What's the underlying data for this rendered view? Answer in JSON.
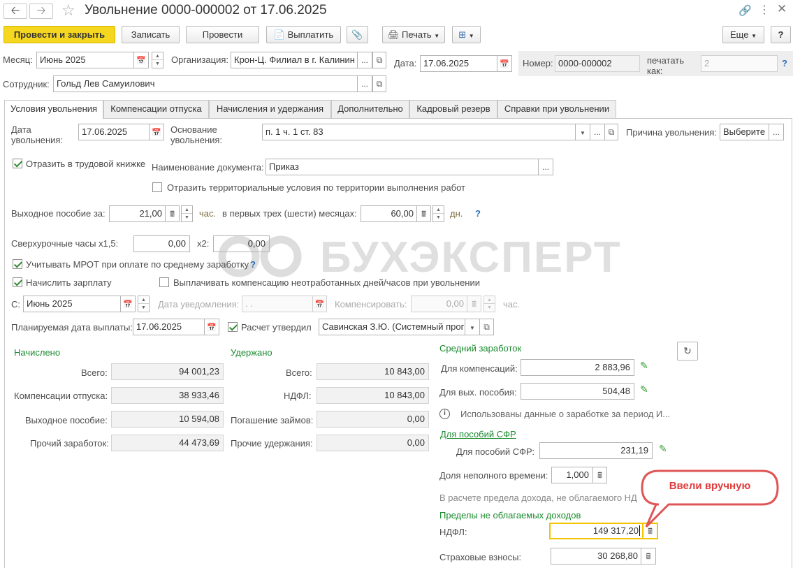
{
  "window": {
    "title": "Увольнение 0000-000002 от 17.06.2025"
  },
  "toolbar": {
    "post_close": "Провести и закрыть",
    "save": "Записать",
    "post": "Провести",
    "pay": "Выплатить",
    "print": "Печать",
    "more": "Еще",
    "help": "?"
  },
  "header": {
    "month_label": "Месяц:",
    "month_value": "Июнь 2025",
    "org_label": "Организация:",
    "org_value": "Крон-Ц. Филиал в г. Калинин",
    "date_label": "Дата:",
    "date_value": "17.06.2025",
    "number_label": "Номер:",
    "number_value": "0000-000002",
    "print_as_label": "печатать как:",
    "print_as_value": "2",
    "employee_label": "Сотрудник:",
    "employee_value": "Гольд Лев Самуилович"
  },
  "tabs": [
    {
      "label": "Условия увольнения"
    },
    {
      "label": "Компенсации отпуска"
    },
    {
      "label": "Начисления и удержания"
    },
    {
      "label": "Дополнительно"
    },
    {
      "label": "Кадровый резерв"
    },
    {
      "label": "Справки при увольнении"
    }
  ],
  "conditions": {
    "dismissal_date_label": "Дата увольнения:",
    "dismissal_date_value": "17.06.2025",
    "basis_label": "Основание увольнения:",
    "basis_value": "п. 1 ч. 1 ст. 83",
    "reason_label": "Причина увольнения:",
    "reason_value": "Выберите",
    "reflect_workbook_label": "Отразить в трудовой книжке",
    "doc_name_label": "Наименование документа:",
    "doc_name_value": "Приказ",
    "territorial_label": "Отразить территориальные условия по территории выполнения работ",
    "severance_label": "Выходное пособие за:",
    "severance_hours": "21,00",
    "hours_unit": "час.",
    "first_months_label": "в первых трех (шести) месяцах:",
    "first_months_days": "60,00",
    "days_unit": "дн.",
    "overtime_label": "Сверхурочные часы х1,5:",
    "overtime_15": "0,00",
    "x2_label": "х2:",
    "overtime_2": "0,00",
    "mrot_label": "Учитывать МРОТ при оплате по среднему заработку",
    "calc_salary_label": "Начислить зарплату",
    "pay_comp_label": "Выплачивать компенсацию неотработанных дней/часов при увольнении",
    "from_label": "С:",
    "from_value": "Июнь 2025",
    "notice_date_label": "Дата уведомления:",
    "notice_date_value": ".  .",
    "compensate_label": "Компенсировать:",
    "compensate_value": "0,00",
    "comp_unit": "час.",
    "planned_pay_label": "Планируемая дата выплаты:",
    "planned_pay_value": "17.06.2025",
    "approved_label": "Расчет утвердил",
    "approved_value": "Савинская З.Ю. (Системный прог"
  },
  "accrued": {
    "title": "Начислено",
    "total_label": "Всего:",
    "total": "94 001,23",
    "vacation_label": "Компенсации отпуска:",
    "vacation": "38 933,46",
    "severance_label": "Выходное пособие:",
    "severance": "10 594,08",
    "other_label": "Прочий заработок:",
    "other": "44 473,69"
  },
  "withheld": {
    "title": "Удержано",
    "total_label": "Всего:",
    "total": "10 843,00",
    "ndfl_label": "НДФЛ:",
    "ndfl": "10 843,00",
    "loans_label": "Погашение займов:",
    "loans": "0,00",
    "other_label": "Прочие удержания:",
    "other": "0,00"
  },
  "average": {
    "title": "Средний заработок",
    "comp_label": "Для компенсаций:",
    "comp": "2 883,96",
    "severance_label": "Для вых. пособия:",
    "severance": "504,48",
    "info_text": "Использованы данные о заработке за период И...",
    "sfr_link": "Для пособий СФР",
    "sfr_label": "Для пособий СФР:",
    "sfr": "231,19",
    "part_time_label": "Доля неполного времени:",
    "part_time": "1,000",
    "limit_note": "В расчете предела дохода, не облагаемого НД",
    "limits_title": "Пределы не облагаемых доходов",
    "ndfl_label": "НДФЛ:",
    "ndfl": "149 317,20",
    "insurance_label": "Страховые взносы:",
    "insurance": "30 268,80"
  },
  "callout": {
    "text": "Ввели вручную"
  },
  "watermark": {
    "text": "БУХЭКСПЕРТ"
  }
}
